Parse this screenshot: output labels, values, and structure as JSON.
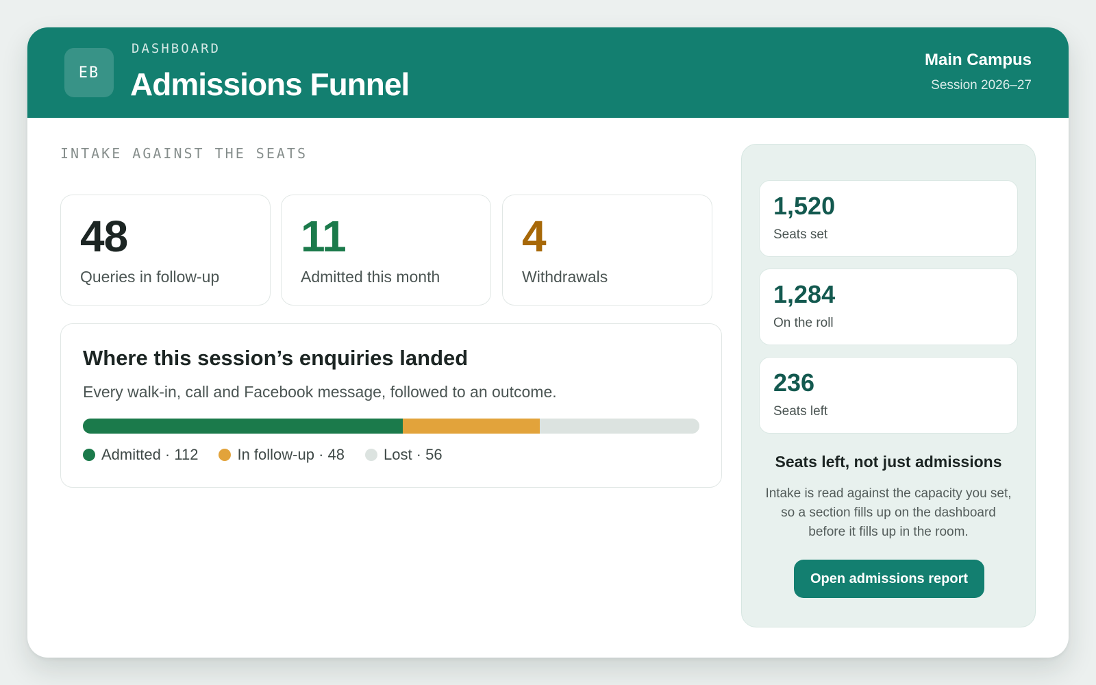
{
  "header": {
    "avatar_initials": "EB",
    "eyebrow": "DASHBOARD",
    "title": "Admissions Funnel",
    "campus": "Main Campus",
    "session": "Session 2026–27"
  },
  "section_label": "INTAKE AGAINST THE SEATS",
  "stats": [
    {
      "value": "48",
      "label": "Queries in follow-up",
      "color": "#1c2523"
    },
    {
      "value": "11",
      "label": "Admitted this month",
      "color": "#1b7a4b"
    },
    {
      "value": "4",
      "label": "Withdrawals",
      "color": "#a76808"
    }
  ],
  "funnel": {
    "title": "Where this session’s enquiries landed",
    "subtitle": "Every walk-in, call and Facebook message, followed to an outcome.",
    "segments": [
      {
        "label": "Admitted · 112",
        "count": 112,
        "color": "#1b7a4b"
      },
      {
        "label": "In follow-up · 48",
        "count": 48,
        "color": "#e2a33b"
      },
      {
        "label": "Lost · 56",
        "count": 56,
        "color": "#dce3e0"
      }
    ]
  },
  "capacity": {
    "kpis": [
      {
        "value": "1,520",
        "label": "Seats set"
      },
      {
        "value": "1,284",
        "label": "On the roll"
      },
      {
        "value": "236",
        "label": "Seats left"
      }
    ],
    "heading": "Seats left, not just admissions",
    "body": "Intake is read against the capacity you set, so a section fills up on the dashboard before it fills up in the room.",
    "cta_label": "Open admissions report"
  },
  "colors": {
    "brand": "#137f70",
    "panel": "#e8f1ee",
    "kpi_value": "#13594f"
  }
}
